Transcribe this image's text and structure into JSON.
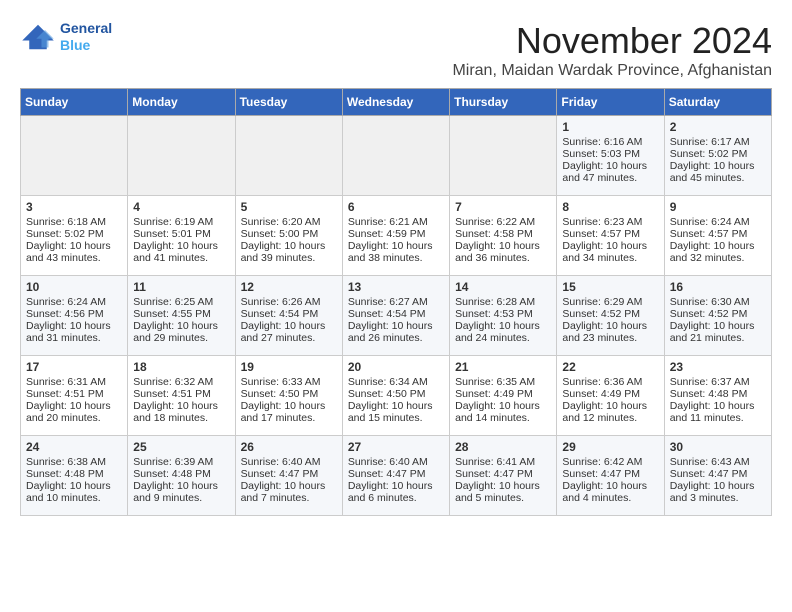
{
  "header": {
    "logo_line1": "General",
    "logo_line2": "Blue",
    "month_title": "November 2024",
    "subtitle": "Miran, Maidan Wardak Province, Afghanistan"
  },
  "weekdays": [
    "Sunday",
    "Monday",
    "Tuesday",
    "Wednesday",
    "Thursday",
    "Friday",
    "Saturday"
  ],
  "weeks": [
    [
      {
        "day": "",
        "empty": true
      },
      {
        "day": "",
        "empty": true
      },
      {
        "day": "",
        "empty": true
      },
      {
        "day": "",
        "empty": true
      },
      {
        "day": "",
        "empty": true
      },
      {
        "day": "1",
        "sunrise": "6:16 AM",
        "sunset": "5:03 PM",
        "daylight": "10 hours and 47 minutes."
      },
      {
        "day": "2",
        "sunrise": "6:17 AM",
        "sunset": "5:02 PM",
        "daylight": "10 hours and 45 minutes."
      }
    ],
    [
      {
        "day": "3",
        "sunrise": "6:18 AM",
        "sunset": "5:02 PM",
        "daylight": "10 hours and 43 minutes."
      },
      {
        "day": "4",
        "sunrise": "6:19 AM",
        "sunset": "5:01 PM",
        "daylight": "10 hours and 41 minutes."
      },
      {
        "day": "5",
        "sunrise": "6:20 AM",
        "sunset": "5:00 PM",
        "daylight": "10 hours and 39 minutes."
      },
      {
        "day": "6",
        "sunrise": "6:21 AM",
        "sunset": "4:59 PM",
        "daylight": "10 hours and 38 minutes."
      },
      {
        "day": "7",
        "sunrise": "6:22 AM",
        "sunset": "4:58 PM",
        "daylight": "10 hours and 36 minutes."
      },
      {
        "day": "8",
        "sunrise": "6:23 AM",
        "sunset": "4:57 PM",
        "daylight": "10 hours and 34 minutes."
      },
      {
        "day": "9",
        "sunrise": "6:24 AM",
        "sunset": "4:57 PM",
        "daylight": "10 hours and 32 minutes."
      }
    ],
    [
      {
        "day": "10",
        "sunrise": "6:24 AM",
        "sunset": "4:56 PM",
        "daylight": "10 hours and 31 minutes."
      },
      {
        "day": "11",
        "sunrise": "6:25 AM",
        "sunset": "4:55 PM",
        "daylight": "10 hours and 29 minutes."
      },
      {
        "day": "12",
        "sunrise": "6:26 AM",
        "sunset": "4:54 PM",
        "daylight": "10 hours and 27 minutes."
      },
      {
        "day": "13",
        "sunrise": "6:27 AM",
        "sunset": "4:54 PM",
        "daylight": "10 hours and 26 minutes."
      },
      {
        "day": "14",
        "sunrise": "6:28 AM",
        "sunset": "4:53 PM",
        "daylight": "10 hours and 24 minutes."
      },
      {
        "day": "15",
        "sunrise": "6:29 AM",
        "sunset": "4:52 PM",
        "daylight": "10 hours and 23 minutes."
      },
      {
        "day": "16",
        "sunrise": "6:30 AM",
        "sunset": "4:52 PM",
        "daylight": "10 hours and 21 minutes."
      }
    ],
    [
      {
        "day": "17",
        "sunrise": "6:31 AM",
        "sunset": "4:51 PM",
        "daylight": "10 hours and 20 minutes."
      },
      {
        "day": "18",
        "sunrise": "6:32 AM",
        "sunset": "4:51 PM",
        "daylight": "10 hours and 18 minutes."
      },
      {
        "day": "19",
        "sunrise": "6:33 AM",
        "sunset": "4:50 PM",
        "daylight": "10 hours and 17 minutes."
      },
      {
        "day": "20",
        "sunrise": "6:34 AM",
        "sunset": "4:50 PM",
        "daylight": "10 hours and 15 minutes."
      },
      {
        "day": "21",
        "sunrise": "6:35 AM",
        "sunset": "4:49 PM",
        "daylight": "10 hours and 14 minutes."
      },
      {
        "day": "22",
        "sunrise": "6:36 AM",
        "sunset": "4:49 PM",
        "daylight": "10 hours and 12 minutes."
      },
      {
        "day": "23",
        "sunrise": "6:37 AM",
        "sunset": "4:48 PM",
        "daylight": "10 hours and 11 minutes."
      }
    ],
    [
      {
        "day": "24",
        "sunrise": "6:38 AM",
        "sunset": "4:48 PM",
        "daylight": "10 hours and 10 minutes."
      },
      {
        "day": "25",
        "sunrise": "6:39 AM",
        "sunset": "4:48 PM",
        "daylight": "10 hours and 9 minutes."
      },
      {
        "day": "26",
        "sunrise": "6:40 AM",
        "sunset": "4:47 PM",
        "daylight": "10 hours and 7 minutes."
      },
      {
        "day": "27",
        "sunrise": "6:40 AM",
        "sunset": "4:47 PM",
        "daylight": "10 hours and 6 minutes."
      },
      {
        "day": "28",
        "sunrise": "6:41 AM",
        "sunset": "4:47 PM",
        "daylight": "10 hours and 5 minutes."
      },
      {
        "day": "29",
        "sunrise": "6:42 AM",
        "sunset": "4:47 PM",
        "daylight": "10 hours and 4 minutes."
      },
      {
        "day": "30",
        "sunrise": "6:43 AM",
        "sunset": "4:47 PM",
        "daylight": "10 hours and 3 minutes."
      }
    ]
  ],
  "labels": {
    "sunrise_prefix": "Sunrise: ",
    "sunset_prefix": "Sunset: ",
    "daylight_prefix": "Daylight: "
  }
}
